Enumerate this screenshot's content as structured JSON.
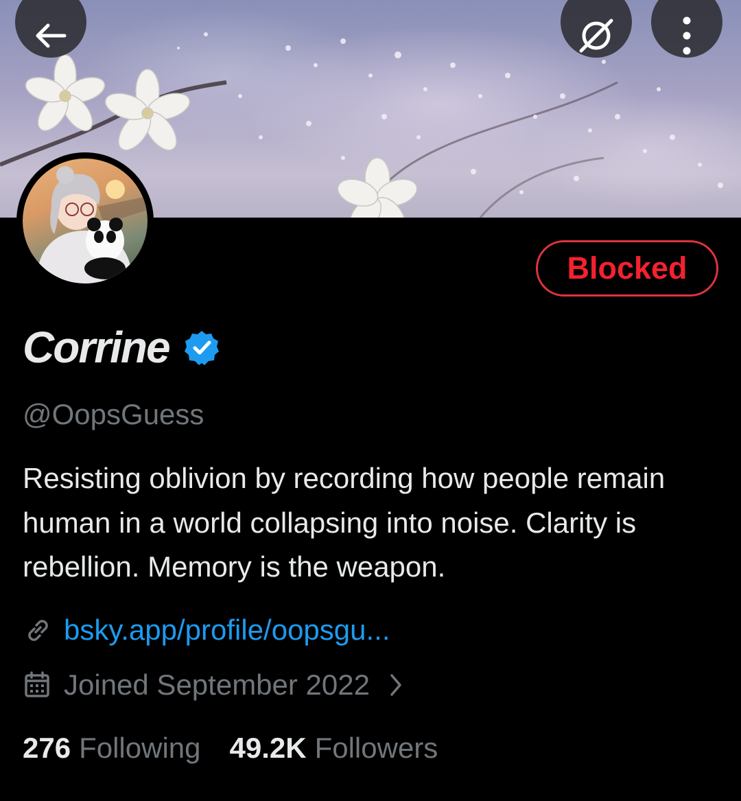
{
  "header": {
    "back_icon": "arrow-left-icon",
    "grok_icon": "slash-circle-icon",
    "more_icon": "more-vertical-icon"
  },
  "profile": {
    "action_button": "Blocked",
    "display_name": "Corrine",
    "verified_icon": "verified-badge-icon",
    "handle": "@OopsGuess",
    "bio": "Resisting oblivion by recording how people remain human in a world collapsing into noise. Clarity is rebellion. Memory is the weapon.",
    "link_icon": "link-icon",
    "link": "bsky.app/profile/oopsgu...",
    "joined_icon": "calendar-icon",
    "joined": "Joined September 2022",
    "following_count": "276",
    "following_label": "Following",
    "followers_count": "49.2K",
    "followers_label": "Followers"
  },
  "colors": {
    "background": "#000000",
    "text": "#e7e9ea",
    "muted": "#71767b",
    "link": "#1d9bf0",
    "blocked": "#f4212e",
    "verified": "#1d9bf0"
  }
}
